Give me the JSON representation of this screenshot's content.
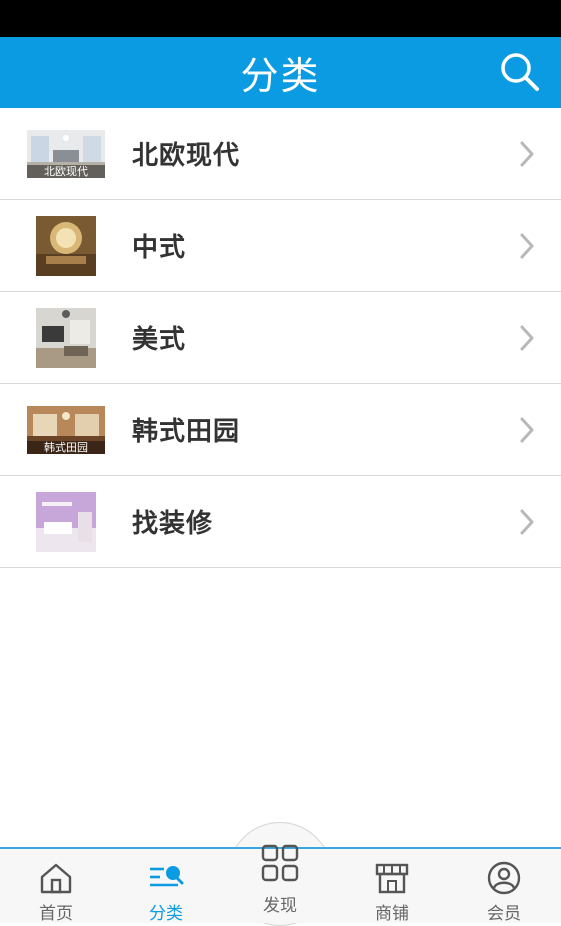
{
  "header": {
    "title": "分类"
  },
  "categories": [
    {
      "label": "北欧现代",
      "thumb_caption": "北欧现代"
    },
    {
      "label": "中式"
    },
    {
      "label": "美式"
    },
    {
      "label": "韩式田园",
      "thumb_caption": "韩式田园"
    },
    {
      "label": "找装修"
    }
  ],
  "tabbar": {
    "tabs": [
      {
        "label": "首页",
        "icon": "home-icon"
      },
      {
        "label": "分类",
        "icon": "category-icon"
      },
      {
        "label": "发现",
        "icon": "grid-icon"
      },
      {
        "label": "商铺",
        "icon": "shop-icon"
      },
      {
        "label": "会员",
        "icon": "user-icon"
      }
    ],
    "active_tab": "分类"
  },
  "colors": {
    "accent": "#0a9be3",
    "statusbar": "#000000",
    "text": "#333333",
    "tab_inactive": "#666666"
  }
}
